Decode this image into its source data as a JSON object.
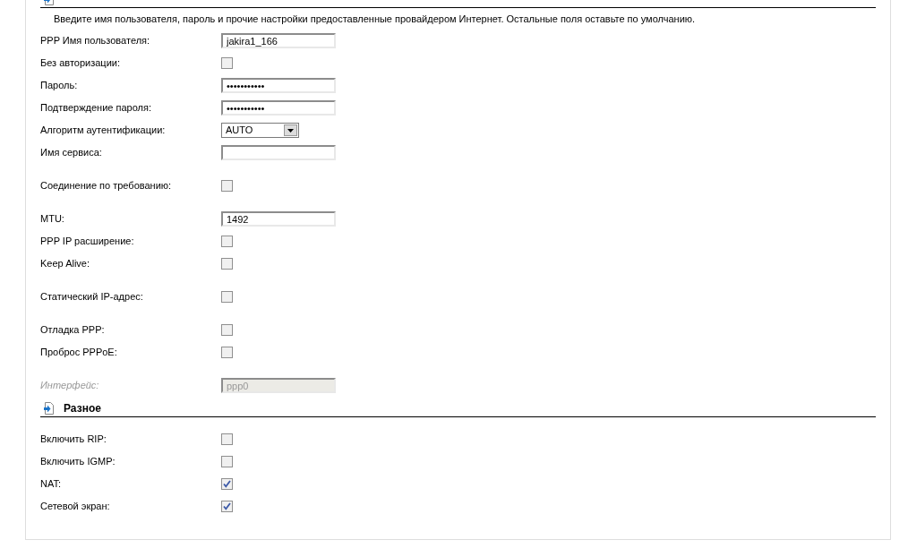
{
  "sections": [
    {
      "intro": "Введите имя пользователя, пароль и прочие настройки предоставленные провайдером Интернет. Остальные поля оставьте по умолчанию.",
      "groups": [
        [
          {
            "kind": "text",
            "label": "PPP Имя пользователя:",
            "value": "jakira1_166",
            "disabled": false
          },
          {
            "kind": "checkbox",
            "label": "Без авторизации:",
            "checked": false
          },
          {
            "kind": "password",
            "label": "Пароль:",
            "value": "•••••••••••",
            "disabled": false
          },
          {
            "kind": "password",
            "label": "Подтверждение пароля:",
            "value": "•••••••••••",
            "disabled": false
          },
          {
            "kind": "select",
            "label": "Алгоритм аутентификации:",
            "value": "AUTO"
          },
          {
            "kind": "text",
            "label": "Имя сервиса:",
            "disabled": false
          }
        ],
        [
          {
            "kind": "checkbox",
            "label": "Соединение по требованию:",
            "checked": false
          }
        ],
        [
          {
            "kind": "text",
            "label": "MTU:",
            "value": "1492",
            "disabled": false
          },
          {
            "kind": "checkbox",
            "label": "PPP IP расширение:",
            "checked": false
          },
          {
            "kind": "checkbox",
            "label": "Keep Alive:",
            "checked": false
          }
        ],
        [
          {
            "kind": "checkbox",
            "label": "Статический IP-адрес:",
            "checked": false
          }
        ],
        [
          {
            "kind": "checkbox",
            "label": "Отладка PPP:",
            "checked": false
          },
          {
            "kind": "checkbox",
            "label": "Проброс PPPoE:",
            "checked": false
          }
        ],
        [
          {
            "kind": "text",
            "label": "Интерфейс:",
            "value": "ppp0",
            "disabled": true
          }
        ]
      ]
    },
    {
      "title": "Разное",
      "groups": [
        [
          {
            "kind": "checkbox",
            "label": "Включить RIP:",
            "checked": false
          },
          {
            "kind": "checkbox",
            "label": "Включить IGMP:",
            "checked": false
          },
          {
            "kind": "checkbox",
            "label": "NAT:",
            "checked": true
          },
          {
            "kind": "checkbox",
            "label": "Сетевой экран:",
            "checked": true
          }
        ]
      ]
    }
  ]
}
